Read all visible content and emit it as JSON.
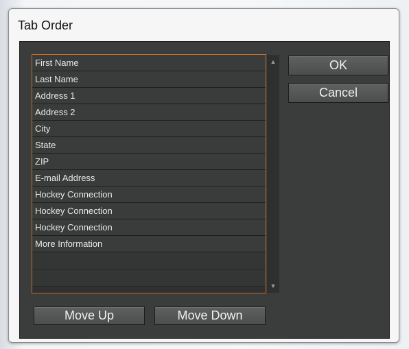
{
  "window": {
    "title": "Tab Order"
  },
  "list": {
    "items": [
      "First Name",
      "Last Name",
      "Address 1",
      "Address 2",
      "City",
      "State",
      "ZIP",
      "E-mail Address",
      "Hockey Connection",
      "Hockey Connection",
      "Hockey Connection",
      "More Information"
    ]
  },
  "scrollbar": {
    "up_icon": "triangle-up-icon",
    "down_icon": "triangle-down-icon"
  },
  "buttons": {
    "ok": "OK",
    "cancel": "Cancel",
    "move_up": "Move Up",
    "move_down": "Move Down"
  },
  "colors": {
    "panel": "#3b3d3c",
    "list_border": "#c46d2e",
    "button": "#555756",
    "text": "#e8e8e8"
  }
}
